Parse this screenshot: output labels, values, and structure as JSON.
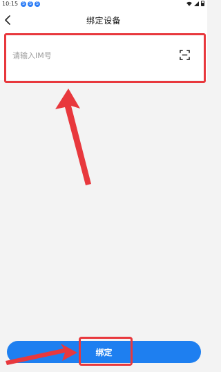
{
  "status_bar": {
    "time": "10:15",
    "notification_icons": [
      "app-notification-icon",
      "app-notification-icon",
      "app-notification-icon"
    ]
  },
  "header": {
    "title": "绑定设备",
    "back_icon": "chevron-left-icon"
  },
  "form": {
    "im_input_placeholder": "请输入IM号",
    "im_input_value": "",
    "scan_icon": "scan-icon"
  },
  "footer": {
    "bind_label": "绑定"
  },
  "colors": {
    "accent": "#1e7ff0",
    "annotation": "#e8383d",
    "page_background": "#f3f3f3"
  }
}
